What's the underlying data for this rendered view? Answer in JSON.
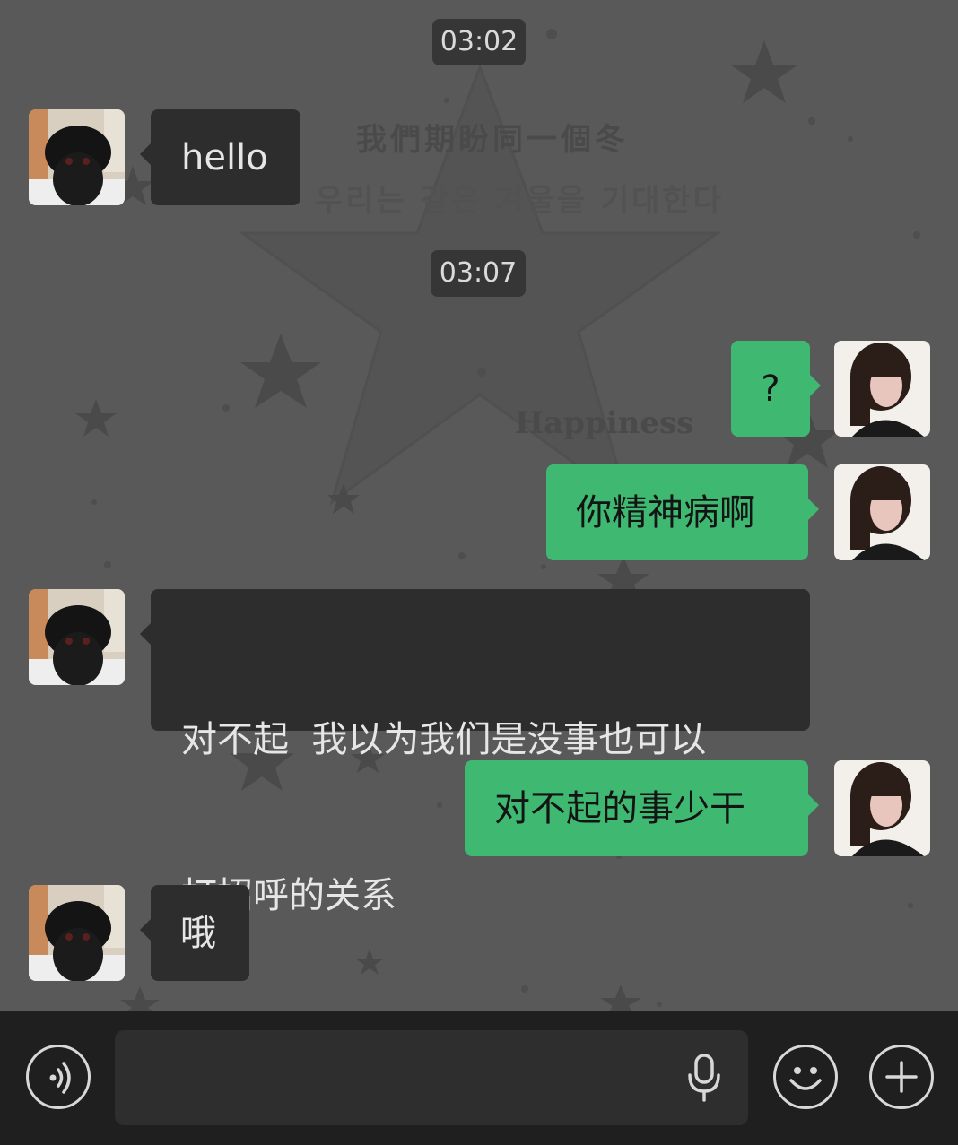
{
  "background": {
    "line_chinese": "我們期盼同一個冬",
    "line_korean": "우리는 같은 겨울을 기대한다",
    "word": "Happiness"
  },
  "timestamps": [
    "03:02",
    "03:07"
  ],
  "messages": [
    {
      "side": "incoming",
      "text": "hello"
    },
    {
      "side": "outgoing",
      "text": "?"
    },
    {
      "side": "outgoing",
      "text": "你精神病啊"
    },
    {
      "side": "incoming",
      "line1": "对不起  我以为我们是没事也可以",
      "line2": "打招呼的关系"
    },
    {
      "side": "outgoing",
      "text": "对不起的事少干"
    },
    {
      "side": "incoming",
      "text": "哦"
    }
  ],
  "input_bar": {
    "voice_mode_icon": "voice-wave-icon",
    "microphone_icon": "microphone-icon",
    "emoji_icon": "smiley-icon",
    "more_icon": "plus-circle-icon",
    "message_value": ""
  },
  "colors": {
    "background": "#595959",
    "incoming_bubble": "#2d2d2d",
    "outgoing_bubble": "#3fb872",
    "time_chip": "#363636",
    "input_bar": "#1f1f1f"
  }
}
